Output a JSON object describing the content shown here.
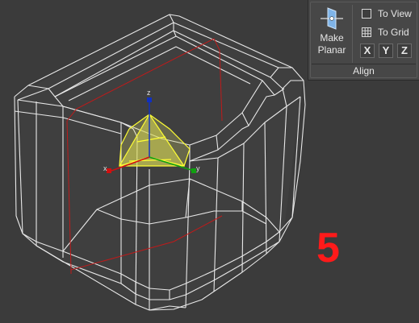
{
  "ribbon": {
    "make_planar_line1": "Make",
    "make_planar_line2": "Planar",
    "to_view_label": "To View",
    "to_grid_label": "To Grid",
    "axis_x": "X",
    "axis_y": "Y",
    "axis_z": "Z",
    "group_label": "Align"
  },
  "viewport": {
    "gizmo_labels": {
      "x": "x",
      "y": "y",
      "z": "z"
    }
  },
  "annotation": {
    "step_number": "5"
  },
  "colors": {
    "viewport_bg": "#3b3b3b",
    "wire": "#e8e8e8",
    "selection": "#ffff33",
    "selection_fill": "#d8d84a",
    "seam": "#c01a1a",
    "step_number": "#ff1a1a",
    "gizmo_x": "#d01010",
    "gizmo_y": "#10a010",
    "gizmo_z": "#1030c0"
  }
}
